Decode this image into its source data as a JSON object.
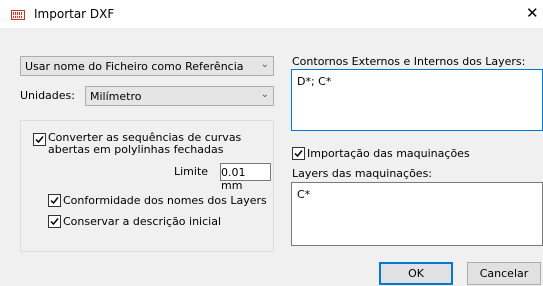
{
  "window": {
    "title": "Importar DXF",
    "app_icon": "dxf-file-icon",
    "close_glyph": "✕"
  },
  "reference_combo": {
    "value": "Usar nome do Ficheiro como Referência"
  },
  "units": {
    "label": "Unidades:",
    "value": "Milímetro"
  },
  "curves_group": {
    "convert_label_line1": "Converter as sequências de curvas",
    "convert_label_line2": "abertas em polylinhas fechadas",
    "convert_checked": true,
    "limit_label": "Limite",
    "limit_value": "0.01 mm",
    "layer_names_label": "Conformidade dos nomes dos Layers",
    "layer_names_checked": true,
    "keep_description_label": "Conservar a descrição inicial",
    "keep_description_checked": true
  },
  "contours": {
    "label": "Contornos Externos e Internos dos Layers:",
    "value": "D*; C*"
  },
  "machining": {
    "import_label": "Importação das maquinações",
    "import_checked": true,
    "layers_label": "Layers das maquinações:",
    "layers_value": "C*"
  },
  "buttons": {
    "ok": "OK",
    "cancel": "Cancelar"
  },
  "colors": {
    "dialog_bg": "#f0f0f0",
    "focus_border": "#0078d7",
    "icon_accent": "#c0392b"
  }
}
